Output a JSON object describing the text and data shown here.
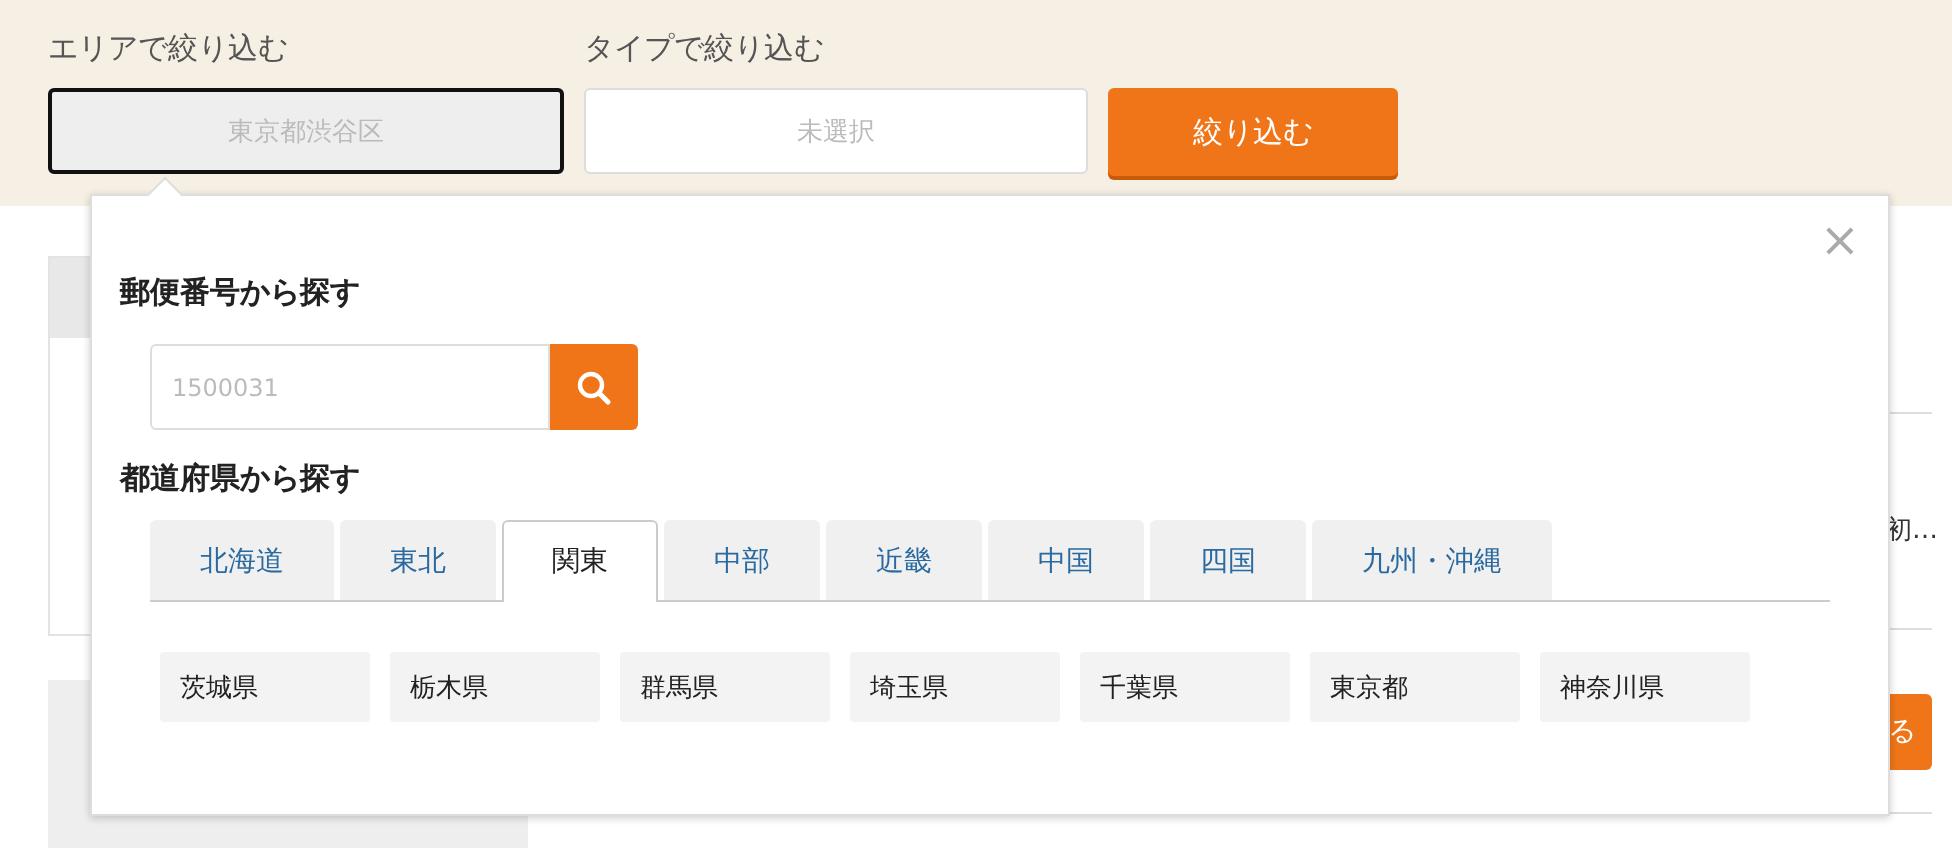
{
  "filters": [
    {
      "label": "エリアで絞り込む",
      "value": "東京都渋谷区",
      "focused": true
    },
    {
      "label": "タイプで絞り込む",
      "value": "未選択",
      "focused": false
    }
  ],
  "filter_button": "絞り込む",
  "background": {
    "snippet": "初…",
    "button_fragment": "る"
  },
  "area_popup": {
    "close": "×",
    "postal_heading": "郵便番号から探す",
    "postal_field": {
      "placeholder": "1500031"
    },
    "prefecture_heading": "都道府県から探す",
    "regions": [
      {
        "label": "北海道",
        "selected": false
      },
      {
        "label": "東北",
        "selected": false
      },
      {
        "label": "関東",
        "selected": true
      },
      {
        "label": "中部",
        "selected": false
      },
      {
        "label": "近畿",
        "selected": false
      },
      {
        "label": "中国",
        "selected": false
      },
      {
        "label": "四国",
        "selected": false
      },
      {
        "label": "九州・沖縄",
        "selected": false
      }
    ],
    "prefectures": [
      "茨城県",
      "栃木県",
      "群馬県",
      "埼玉県",
      "千葉県",
      "東京都",
      "神奈川県"
    ]
  }
}
